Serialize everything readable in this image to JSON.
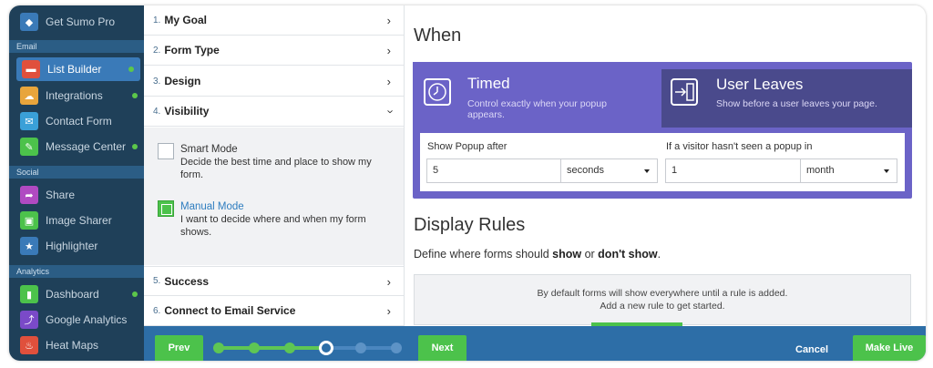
{
  "sidebar": {
    "top": {
      "label": "Get Sumo Pro",
      "icon": "diamond-icon"
    },
    "sections": [
      {
        "label": "Email"
      },
      {
        "label": "Social"
      },
      {
        "label": "Analytics"
      }
    ],
    "items": [
      {
        "label": "List Builder",
        "icon": "list-builder-icon",
        "color": "#e0503c",
        "active": true,
        "dot": true
      },
      {
        "label": "Integrations",
        "icon": "integrations-icon",
        "color": "#e8a53c",
        "dot": true
      },
      {
        "label": "Contact Form",
        "icon": "contact-form-icon",
        "color": "#3aa0d8",
        "dot": false
      },
      {
        "label": "Message Center",
        "icon": "message-center-icon",
        "color": "#4cc24b",
        "dot": true
      },
      {
        "label": "Share",
        "icon": "share-icon",
        "color": "#b04ac2",
        "dot": false
      },
      {
        "label": "Image Sharer",
        "icon": "image-sharer-icon",
        "color": "#4cc24b",
        "dot": false
      },
      {
        "label": "Highlighter",
        "icon": "highlighter-icon",
        "color": "#3a7ab8",
        "dot": false
      },
      {
        "label": "Dashboard",
        "icon": "dashboard-icon",
        "color": "#4cc24b",
        "dot": true
      },
      {
        "label": "Google Analytics",
        "icon": "google-analytics-icon",
        "color": "#7a4ac8",
        "dot": false
      },
      {
        "label": "Heat Maps",
        "icon": "heat-maps-icon",
        "color": "#e0503c",
        "dot": false
      }
    ]
  },
  "steps": [
    {
      "num": "1.",
      "title": "My Goal"
    },
    {
      "num": "2.",
      "title": "Form Type"
    },
    {
      "num": "3.",
      "title": "Design"
    },
    {
      "num": "4.",
      "title": "Visibility"
    },
    {
      "num": "5.",
      "title": "Success"
    },
    {
      "num": "6.",
      "title": "Connect to Email Service"
    }
  ],
  "visibility": {
    "smart": {
      "title": "Smart Mode",
      "desc": "Decide the best time and place to show my form."
    },
    "manual": {
      "title": "Manual Mode",
      "desc": "I want to decide where and when my form shows.",
      "checked": true
    }
  },
  "when": {
    "heading": "When",
    "timed": {
      "title": "Timed",
      "desc": "Control exactly when your popup appears."
    },
    "leaves": {
      "title": "User Leaves",
      "desc": "Show before a user leaves your page."
    },
    "show_after_label": "Show Popup after",
    "show_after_value": "5",
    "show_after_unit": "seconds",
    "not_seen_label": "If a visitor hasn't seen a popup in",
    "not_seen_value": "1",
    "not_seen_unit": "month"
  },
  "rules": {
    "heading": "Display Rules",
    "desc_prefix": "Define where forms should ",
    "desc_show": "show",
    "desc_or": " or ",
    "desc_dont": "don't show",
    "desc_end": ".",
    "box_line1": "By default forms will show everywhere until a rule is added.",
    "box_line2": "Add a new rule to get started."
  },
  "bottom": {
    "prev": "Prev",
    "next": "Next",
    "cancel": "Cancel",
    "make_live": "Make Live",
    "progress_current_step": 4,
    "progress_total_steps": 6
  }
}
